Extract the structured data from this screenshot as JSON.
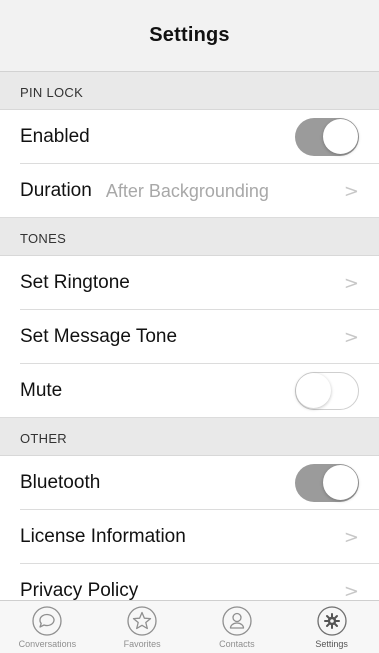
{
  "header": {
    "title": "Settings"
  },
  "sections": {
    "pin_lock": {
      "title": "PIN LOCK",
      "enabled": {
        "label": "Enabled",
        "toggle_on": true
      },
      "duration": {
        "label": "Duration",
        "value": "After Backgrounding"
      }
    },
    "tones": {
      "title": "TONES",
      "set_ringtone": {
        "label": "Set Ringtone"
      },
      "set_message_tone": {
        "label": "Set Message Tone"
      },
      "mute": {
        "label": "Mute",
        "toggle_on": false
      }
    },
    "other": {
      "title": "OTHER",
      "bluetooth": {
        "label": "Bluetooth",
        "toggle_on": true
      },
      "license": {
        "label": "License Information"
      },
      "privacy": {
        "label": "Privacy Policy"
      }
    }
  },
  "chevron_glyph": ">",
  "tabs": [
    {
      "label": "Conversations",
      "icon": "chat-bubble-icon",
      "active": false
    },
    {
      "label": "Favorites",
      "icon": "star-icon",
      "active": false
    },
    {
      "label": "Contacts",
      "icon": "person-icon",
      "active": false
    },
    {
      "label": "Settings",
      "icon": "gear-icon",
      "active": true
    }
  ],
  "colors": {
    "toggle_on": "#9b9b9b",
    "section_bg": "#e9e9e9",
    "detail_text": "#a8a8a8",
    "tab_icon": "#8f8f8f"
  }
}
